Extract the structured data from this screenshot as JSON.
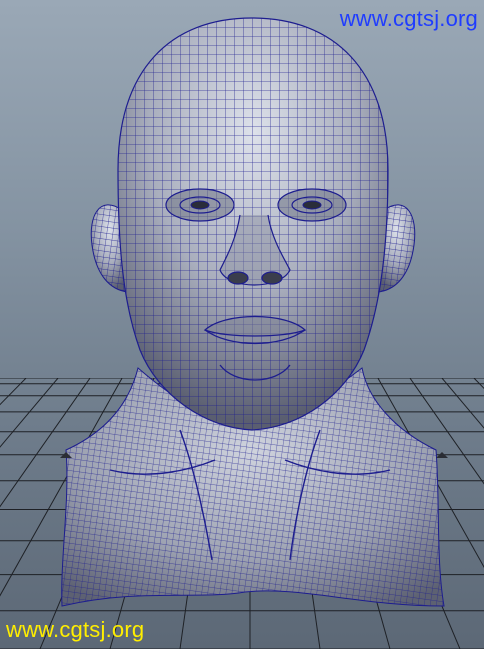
{
  "watermarks": {
    "top_right": "www.cgtsj.org",
    "bottom_left": "www.cgtsj.org"
  },
  "colors": {
    "viewport_background_top": "#9aa8b6",
    "viewport_background_bottom": "#5c6876",
    "grid_line": "#1e2126",
    "mesh_wireframe": "#1d1d8f",
    "mesh_surface_light": "#d8dce6",
    "mesh_surface_dark": "#5a5e70",
    "watermark_top": "#1f3cff",
    "watermark_bottom": "#ffee00"
  },
  "scene": {
    "object": "polygon head and neck bust",
    "display_mode": "shaded with wireframe",
    "ground_grid": true
  }
}
